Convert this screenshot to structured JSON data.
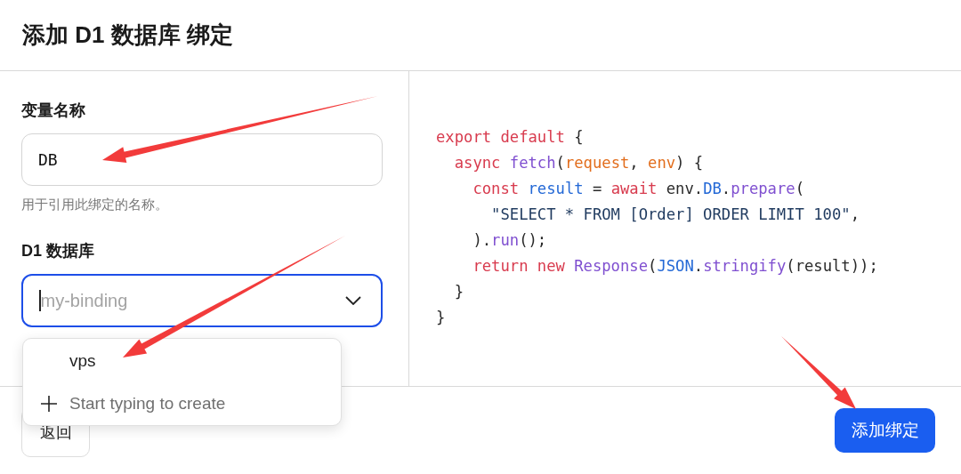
{
  "dialog": {
    "title": "添加 D1 数据库 绑定"
  },
  "variable_field": {
    "label": "变量名称",
    "value": "DB",
    "help": "用于引用此绑定的名称。"
  },
  "database_field": {
    "label": "D1 数据库",
    "placeholder": "my-binding",
    "expanded": true
  },
  "dropdown": {
    "options": [
      {
        "kind": "option",
        "label": "vps"
      },
      {
        "kind": "create",
        "label": "Start typing to create"
      }
    ]
  },
  "code": {
    "lines": [
      [
        {
          "kind": "keyword",
          "text": "export default"
        },
        {
          "kind": "plain",
          "text": " {"
        }
      ],
      [
        {
          "kind": "keyword",
          "text": "  async"
        },
        {
          "kind": "function",
          "text": " fetch"
        },
        {
          "kind": "plain",
          "text": "("
        },
        {
          "kind": "param",
          "text": "request"
        },
        {
          "kind": "plain",
          "text": ", "
        },
        {
          "kind": "param",
          "text": "env"
        },
        {
          "kind": "plain",
          "text": ") {"
        }
      ],
      [
        {
          "kind": "keyword",
          "text": "    const"
        },
        {
          "kind": "variable",
          "text": " result"
        },
        {
          "kind": "plain",
          "text": " = "
        },
        {
          "kind": "keyword",
          "text": "await"
        },
        {
          "kind": "plain",
          "text": " env."
        },
        {
          "kind": "variable",
          "text": "DB"
        },
        {
          "kind": "plain",
          "text": "."
        },
        {
          "kind": "function",
          "text": "prepare"
        },
        {
          "kind": "plain",
          "text": "("
        }
      ],
      [
        {
          "kind": "string",
          "text": "      \"SELECT * FROM [Order] ORDER LIMIT 100\""
        },
        {
          "kind": "plain",
          "text": ","
        }
      ],
      [
        {
          "kind": "plain",
          "text": "    )."
        },
        {
          "kind": "function",
          "text": "run"
        },
        {
          "kind": "plain",
          "text": "();"
        }
      ],
      [
        {
          "kind": "keyword",
          "text": "    return new"
        },
        {
          "kind": "function",
          "text": " Response"
        },
        {
          "kind": "plain",
          "text": "("
        },
        {
          "kind": "variable",
          "text": "JSON"
        },
        {
          "kind": "plain",
          "text": "."
        },
        {
          "kind": "function",
          "text": "stringify"
        },
        {
          "kind": "plain",
          "text": "(result));"
        }
      ],
      [
        {
          "kind": "plain",
          "text": "  }"
        }
      ],
      [
        {
          "kind": "plain",
          "text": "}"
        }
      ]
    ]
  },
  "footer": {
    "back_button": "返回",
    "submit_button": "添加绑定"
  }
}
